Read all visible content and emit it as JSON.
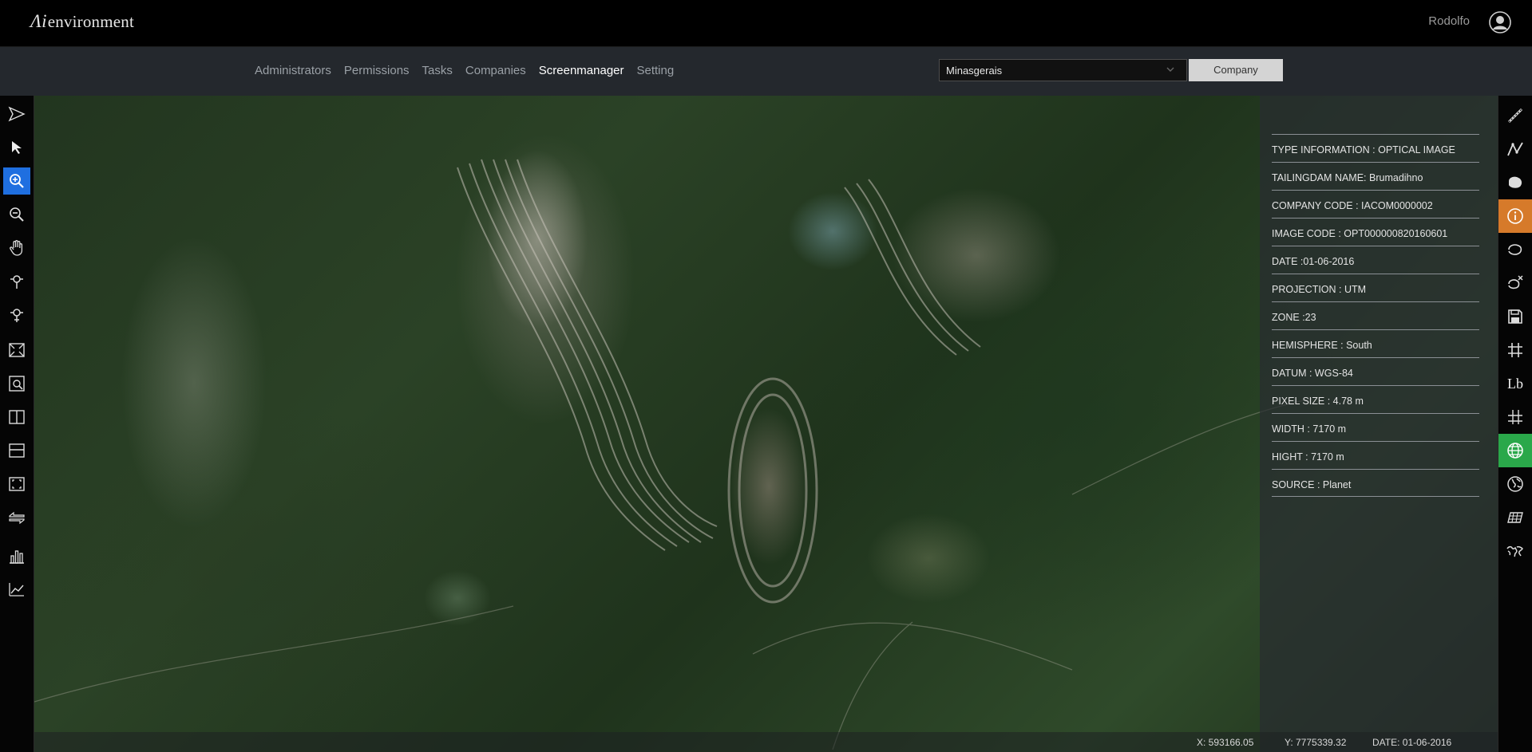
{
  "app": {
    "logo_prefix": "Λi",
    "logo_text": "environment",
    "user_name": "Rodolfo"
  },
  "nav": {
    "items": [
      {
        "label": "Administrators",
        "active": false
      },
      {
        "label": "Permissions",
        "active": false
      },
      {
        "label": "Tasks",
        "active": false
      },
      {
        "label": "Companies",
        "active": false
      },
      {
        "label": "Screenmanager",
        "active": true
      },
      {
        "label": "Setting",
        "active": false
      }
    ],
    "site_select_value": "Minasgerais",
    "company_button_label": "Company"
  },
  "left_toolbar": {
    "tools": [
      "send-arrow-icon",
      "pointer-icon",
      "zoom-in-icon",
      "zoom-out-icon",
      "pan-hand-icon",
      "pin-add-icon",
      "pin-remove-icon",
      "full-extent-icon",
      "zoom-to-layer-icon",
      "split-vertical-icon",
      "split-horizontal-icon",
      "fullscreen-icon",
      "swipe-icon",
      "bar-chart-icon",
      "line-chart-icon"
    ],
    "active_tool": "zoom-in-icon"
  },
  "right_toolbar": {
    "tools": [
      "ruler-icon",
      "polyline-icon",
      "polygon-fill-icon",
      "info-icon",
      "freehand-icon",
      "clear-shape-icon",
      "save-icon",
      "grid-icon",
      "label-icon",
      "graticule-icon",
      "globe-grid-icon",
      "globe-icon",
      "layers-icon",
      "world-map-icon"
    ],
    "label_text": "Lb",
    "active_tools": {
      "info-icon": "#d67a2a",
      "globe-grid-icon": "#2aa84a"
    }
  },
  "info_panel": {
    "rows": [
      "TYPE INFORMATION : OPTICAL IMAGE",
      "TAILINGDAM NAME: Brumadihno",
      "COMPANY CODE : IACOM0000002",
      "IMAGE CODE : OPT000000820160601",
      "DATE :01-06-2016",
      "PROJECTION : UTM",
      "ZONE :23",
      "HEMISPHERE : South",
      "DATUM : WGS-84",
      "PIXEL SIZE : 4.78 m",
      "WIDTH : 7170 m",
      "HIGHT : 7170 m",
      "SOURCE : Planet"
    ]
  },
  "status_bar": {
    "x": "X: 593166.05",
    "y": "Y: 7775339.32",
    "date": "DATE: 01-06-2016"
  },
  "colors": {
    "accent_blue": "#1f6fe0",
    "accent_orange": "#d67a2a",
    "accent_green": "#2aa84a"
  }
}
